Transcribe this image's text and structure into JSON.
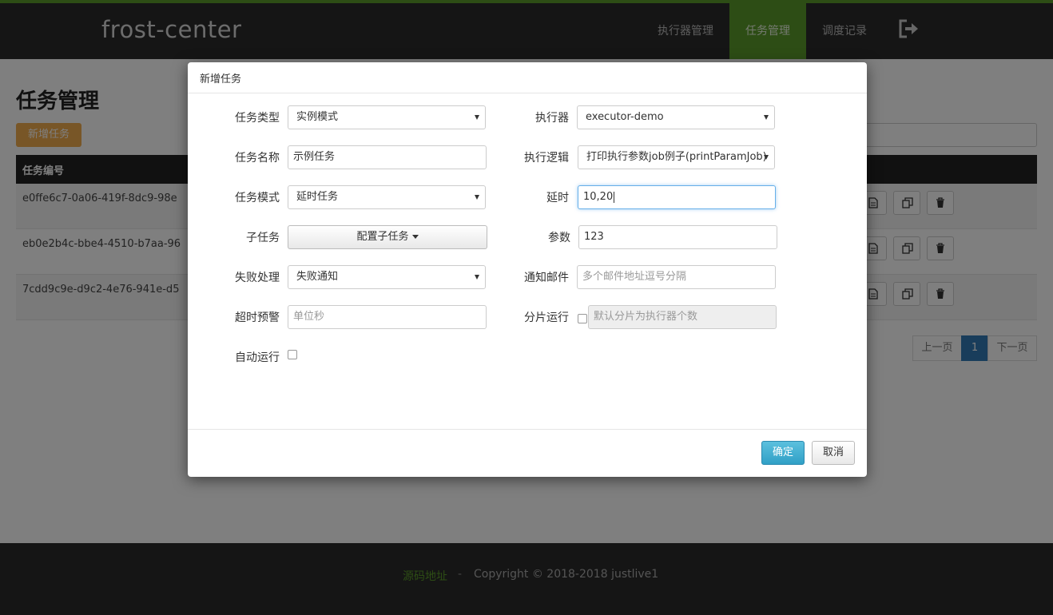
{
  "app": {
    "brand": "frost-center"
  },
  "nav": {
    "items": [
      {
        "label": "执行器管理"
      },
      {
        "label": "任务管理"
      },
      {
        "label": "调度记录"
      }
    ],
    "logout_icon": "sign-out-icon"
  },
  "page": {
    "title": "任务管理",
    "add_button": "新增任务",
    "table_header": "任务编号",
    "rows": [
      {
        "id": "e0ffe6c7-0a06-419f-8dc9-98e"
      },
      {
        "id": "eb0e2b4c-bbe4-4510-b7aa-96"
      },
      {
        "id": "7cdd9c9e-d9c2-4e76-941e-d5"
      }
    ],
    "pagination": {
      "prev": "上一页",
      "current": "1",
      "next": "下一页"
    }
  },
  "footer": {
    "source_link": "源码地址",
    "separator": "-",
    "copyright": "Copyright © 2018-2018 justlive1"
  },
  "modal": {
    "title": "新增任务",
    "fields": {
      "task_type": {
        "label": "任务类型",
        "value": "实例模式"
      },
      "executor": {
        "label": "执行器",
        "value": "executor-demo"
      },
      "task_name": {
        "label": "任务名称",
        "value": "示例任务"
      },
      "exec_logic": {
        "label": "执行逻辑",
        "value": "打印执行参数job例子(printParamJob)"
      },
      "task_mode": {
        "label": "任务模式",
        "value": "延时任务"
      },
      "delay": {
        "label": "延时",
        "value": "10,20"
      },
      "sub_task": {
        "label": "子任务",
        "button": "配置子任务"
      },
      "param": {
        "label": "参数",
        "value": "123"
      },
      "failure": {
        "label": "失败处理",
        "value": "失败通知"
      },
      "notify_email": {
        "label": "通知邮件",
        "placeholder": "多个邮件地址逗号分隔"
      },
      "timeout": {
        "label": "超时预警",
        "placeholder": "单位秒"
      },
      "sharding": {
        "label": "分片运行",
        "placeholder": "默认分片为执行器个数"
      },
      "auto_run": {
        "label": "自动运行"
      }
    },
    "confirm": "确定",
    "cancel": "取消"
  },
  "colors": {
    "accent_green": "#5a9b2a",
    "navbar_bg": "#2b2b2b",
    "primary_button": "#31a0c6",
    "warning_button": "#f0ad4e",
    "pager_active": "#337ab7"
  }
}
